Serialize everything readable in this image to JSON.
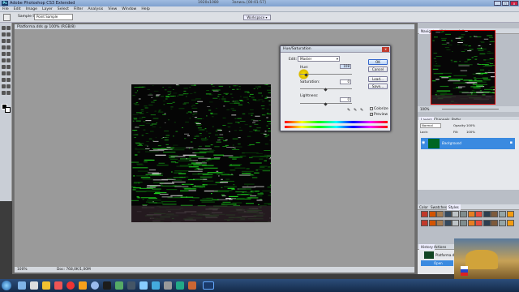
{
  "app": {
    "title": "Adobe Photoshop CS3 Extended",
    "recorder_label": "1920x1080",
    "recorder_status": "Запись [00:01:57]"
  },
  "menu": [
    "File",
    "Edit",
    "Image",
    "Layer",
    "Select",
    "Filter",
    "Analysis",
    "View",
    "Window",
    "Help"
  ],
  "options_bar": {
    "sample_size_label": "Sample Size:",
    "sample_size_value": "Point Sample",
    "workspace_label": "Workspace ▾"
  },
  "document": {
    "tab_title": "Platforma.dds @ 100% (RGB/8)",
    "zoom": "100%",
    "doc_size": "Doc: 768,0K/1,00M"
  },
  "dialog": {
    "title": "Hue/Saturation",
    "edit_label": "Edit:",
    "edit_value": "Master",
    "hue_label": "Hue:",
    "hue_value": "108",
    "saturation_label": "Saturation:",
    "saturation_value": "0",
    "lightness_label": "Lightness:",
    "lightness_value": "0",
    "ok_label": "OK",
    "cancel_label": "Cancel",
    "load_label": "Load...",
    "save_label": "Save...",
    "colorize_label": "Colorize",
    "preview_label": "Preview"
  },
  "panels": {
    "navigator_tabs": [
      "Navigator",
      "Histogram",
      "Info"
    ],
    "navigator_zoom": "100%",
    "layers_tabs": [
      "Layers",
      "Channels",
      "Paths"
    ],
    "blend_mode": "Normal",
    "opacity_label": "Opacity:",
    "opacity_value": "100%",
    "lock_label": "Lock:",
    "fill_label": "Fill:",
    "fill_value": "100%",
    "layer_name": "Background",
    "color_tabs": [
      "Color",
      "Swatches",
      "Styles"
    ],
    "history_tabs": [
      "History",
      "Actions"
    ],
    "history_snapshot": "Platforma.dds",
    "history_step": "Open"
  },
  "colors": {
    "accent_selected": "#3a8ae0",
    "image_green": "#1fd11f"
  }
}
